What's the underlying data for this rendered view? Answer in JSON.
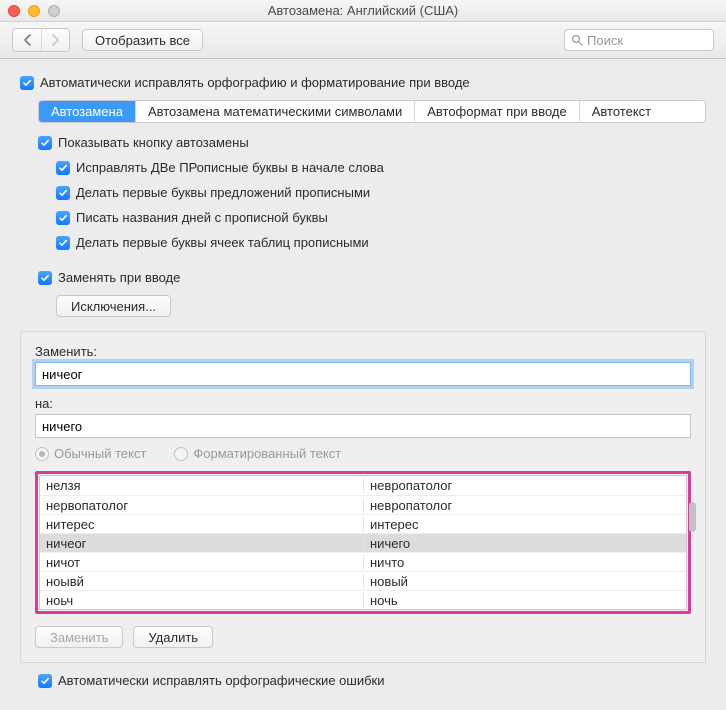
{
  "window": {
    "title": "Автозамена: Английский (США)"
  },
  "toolbar": {
    "show_all": "Отобразить все",
    "search_placeholder": "Поиск"
  },
  "main_checkbox": "Автоматически исправлять орфографию и форматирование при вводе",
  "tabs": {
    "autoreplace": "Автозамена",
    "math": "Автозамена математическими символами",
    "autoformat": "Автоформат при вводе",
    "autotext": "Автотекст"
  },
  "options": {
    "show_button": "Показывать кнопку автозамены",
    "two_caps": "Исправлять ДВе ПРописные буквы в начале слова",
    "sentence_caps": "Делать первые буквы предложений прописными",
    "day_caps": "Писать названия дней с прописной буквы",
    "table_caps": "Делать первые буквы ячеек таблиц прописными",
    "replace_on_type": "Заменять при вводе",
    "exceptions": "Исключения..."
  },
  "form": {
    "replace_label": "Заменить:",
    "replace_value": "ничеог",
    "with_label": "на:",
    "with_value": "ничего",
    "plain_text": "Обычный текст",
    "formatted_text": "Форматированный текст"
  },
  "table": {
    "rows": [
      {
        "from": "нелзя",
        "to": "невропатолог",
        "selected": false
      },
      {
        "from": "нервопатолог",
        "to": "невропатолог",
        "selected": false
      },
      {
        "from": "нитерес",
        "to": "интерес",
        "selected": false
      },
      {
        "from": "ничеог",
        "to": "ничего",
        "selected": true
      },
      {
        "from": "ничот",
        "to": "ничто",
        "selected": false
      },
      {
        "from": "ноывй",
        "to": "новый",
        "selected": false
      },
      {
        "from": "ноьч",
        "to": "ночь",
        "selected": false
      }
    ]
  },
  "buttons": {
    "replace": "Заменить",
    "delete": "Удалить"
  },
  "footer_checkbox": "Автоматически исправлять орфографические ошибки"
}
